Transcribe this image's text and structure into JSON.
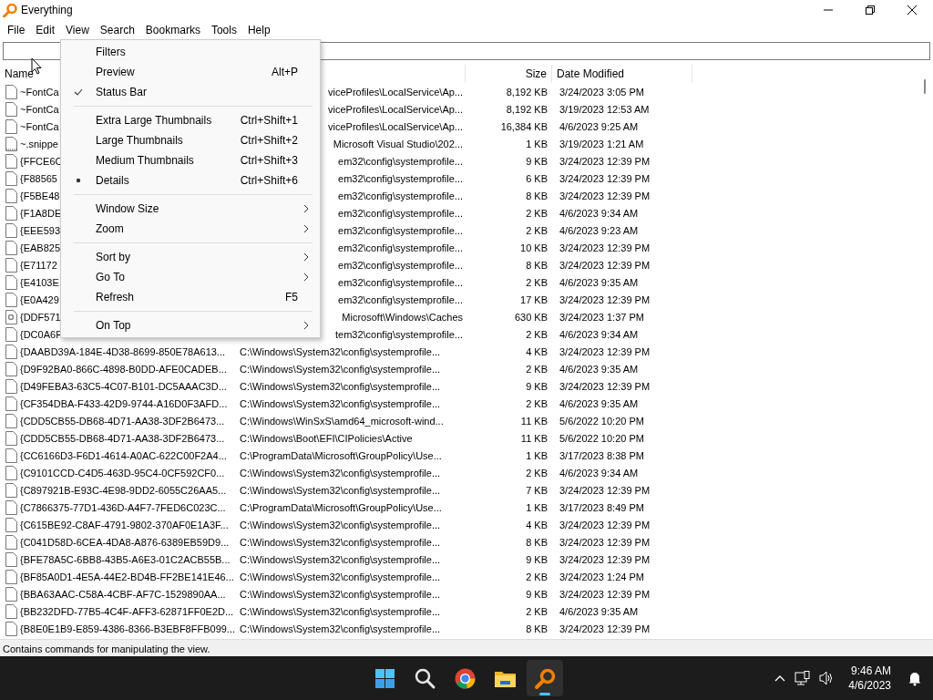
{
  "window": {
    "title": "Everything"
  },
  "menubar": [
    {
      "label": "File"
    },
    {
      "label": "Edit"
    },
    {
      "label": "View"
    },
    {
      "label": "Search"
    },
    {
      "label": "Bookmarks"
    },
    {
      "label": "Tools"
    },
    {
      "label": "Help"
    }
  ],
  "view_menu": [
    [
      {
        "kind": "command",
        "label": "Filters"
      },
      {
        "kind": "command",
        "label": "Preview",
        "shortcut": "Alt+P"
      },
      {
        "kind": "check",
        "label": "Status Bar",
        "checked": true
      }
    ],
    [
      {
        "kind": "radio",
        "label": "Extra Large Thumbnails",
        "shortcut": "Ctrl+Shift+1",
        "checked": false
      },
      {
        "kind": "radio",
        "label": "Large Thumbnails",
        "shortcut": "Ctrl+Shift+2",
        "checked": false
      },
      {
        "kind": "radio",
        "label": "Medium Thumbnails",
        "shortcut": "Ctrl+Shift+3",
        "checked": false
      },
      {
        "kind": "radio",
        "label": "Details",
        "shortcut": "Ctrl+Shift+6",
        "checked": true
      }
    ],
    [
      {
        "kind": "submenu",
        "label": "Window Size"
      },
      {
        "kind": "submenu",
        "label": "Zoom"
      }
    ],
    [
      {
        "kind": "submenu",
        "label": "Sort by"
      },
      {
        "kind": "submenu",
        "label": "Go To"
      },
      {
        "kind": "command",
        "label": "Refresh",
        "shortcut": "F5"
      }
    ],
    [
      {
        "kind": "submenu",
        "label": "On Top"
      }
    ]
  ],
  "table": {
    "columns": [
      {
        "label": "Name"
      },
      {
        "label": "Size"
      },
      {
        "label": "Date Modified"
      }
    ],
    "rows": [
      {
        "kind": "plain",
        "covered": true,
        "name": "~FontCa",
        "path": "viceProfiles\\LocalService\\Ap...",
        "size": "8,192 KB",
        "date": "3/24/2023 3:05 PM"
      },
      {
        "kind": "plain",
        "covered": true,
        "name": "~FontCa",
        "path": "viceProfiles\\LocalService\\Ap...",
        "size": "8,192 KB",
        "date": "3/19/2023 12:53 AM"
      },
      {
        "kind": "plain",
        "covered": true,
        "name": "~FontCa",
        "path": "viceProfiles\\LocalService\\Ap...",
        "size": "16,384 KB",
        "date": "4/6/2023 9:25 AM"
      },
      {
        "kind": "dotted",
        "covered": true,
        "name": "~.snippe",
        "path": "Microsoft Visual Studio\\202...",
        "size": "1 KB",
        "date": "3/19/2023 1:21 AM"
      },
      {
        "kind": "plain",
        "covered": true,
        "name": "{FFCE6C",
        "path": "em32\\config\\systemprofile...",
        "size": "9 KB",
        "date": "3/24/2023 12:39 PM"
      },
      {
        "kind": "plain",
        "covered": true,
        "name": "{F88565",
        "path": "em32\\config\\systemprofile...",
        "size": "6 KB",
        "date": "3/24/2023 12:39 PM"
      },
      {
        "kind": "plain",
        "covered": true,
        "name": "{F5BE48",
        "path": "em32\\config\\systemprofile...",
        "size": "8 KB",
        "date": "3/24/2023 12:39 PM"
      },
      {
        "kind": "plain",
        "covered": true,
        "name": "{F1A8DE",
        "path": "em32\\config\\systemprofile...",
        "size": "2 KB",
        "date": "4/6/2023 9:34 AM"
      },
      {
        "kind": "plain",
        "covered": true,
        "name": "{EEE593",
        "path": "em32\\config\\systemprofile...",
        "size": "2 KB",
        "date": "4/6/2023 9:23 AM"
      },
      {
        "kind": "plain",
        "covered": true,
        "name": "{EAB825",
        "path": "em32\\config\\systemprofile...",
        "size": "10 KB",
        "date": "3/24/2023 12:39 PM"
      },
      {
        "kind": "plain",
        "covered": true,
        "name": "{E71172",
        "path": "em32\\config\\systemprofile...",
        "size": "8 KB",
        "date": "3/24/2023 12:39 PM"
      },
      {
        "kind": "plain",
        "covered": true,
        "name": "{E4103E",
        "path": "em32\\config\\systemprofile...",
        "size": "2 KB",
        "date": "4/6/2023 9:35 AM"
      },
      {
        "kind": "plain",
        "covered": true,
        "name": "{E0A429",
        "path": "em32\\config\\systemprofile...",
        "size": "17 KB",
        "date": "3/24/2023 12:39 PM"
      },
      {
        "kind": "badge",
        "covered": true,
        "name": "{DDF571",
        "path": "Microsoft\\Windows\\Caches",
        "size": "630 KB",
        "date": "3/24/2023 1:37 PM"
      },
      {
        "kind": "plain",
        "covered": true,
        "name": "{DC0A6F",
        "path": "tem32\\config\\systemprofile...",
        "size": "2 KB",
        "date": "4/6/2023 9:34 AM"
      },
      {
        "kind": "plain",
        "covered": false,
        "name": "{DAABD39A-184E-4D38-8699-850E78A613...",
        "path": "C:\\Windows\\System32\\config\\systemprofile...",
        "size": "4 KB",
        "date": "3/24/2023 12:39 PM"
      },
      {
        "kind": "plain",
        "covered": false,
        "name": "{D9F92BA0-866C-4898-B0DD-AFE0CADEB...",
        "path": "C:\\Windows\\System32\\config\\systemprofile...",
        "size": "2 KB",
        "date": "4/6/2023 9:35 AM"
      },
      {
        "kind": "plain",
        "covered": false,
        "name": "{D49FEBA3-63C5-4C07-B101-DC5AAAC3D...",
        "path": "C:\\Windows\\System32\\config\\systemprofile...",
        "size": "9 KB",
        "date": "3/24/2023 12:39 PM"
      },
      {
        "kind": "plain",
        "covered": false,
        "name": "{CF354DBA-F433-42D9-9744-A16D0F3AFD...",
        "path": "C:\\Windows\\System32\\config\\systemprofile...",
        "size": "2 KB",
        "date": "4/6/2023 9:35 AM"
      },
      {
        "kind": "plain",
        "covered": false,
        "name": "{CDD5CB55-DB68-4D71-AA38-3DF2B6473...",
        "path": "C:\\Windows\\WinSxS\\amd64_microsoft-wind...",
        "size": "11 KB",
        "date": "5/6/2022 10:20 PM"
      },
      {
        "kind": "plain",
        "covered": false,
        "name": "{CDD5CB55-DB68-4D71-AA38-3DF2B6473...",
        "path": "C:\\Windows\\Boot\\EFI\\CIPolicies\\Active",
        "size": "11 KB",
        "date": "5/6/2022 10:20 PM"
      },
      {
        "kind": "plain",
        "covered": false,
        "name": "{CC6166D3-F6D1-4614-A0AC-622C00F2A4...",
        "path": "C:\\ProgramData\\Microsoft\\GroupPolicy\\Use...",
        "size": "1 KB",
        "date": "3/17/2023 8:38 PM"
      },
      {
        "kind": "plain",
        "covered": false,
        "name": "{C9101CCD-C4D5-463D-95C4-0CF592CF0...",
        "path": "C:\\Windows\\System32\\config\\systemprofile...",
        "size": "2 KB",
        "date": "4/6/2023 9:34 AM"
      },
      {
        "kind": "plain",
        "covered": false,
        "name": "{C897921B-E93C-4E98-9DD2-6055C26AA5...",
        "path": "C:\\Windows\\System32\\config\\systemprofile...",
        "size": "7 KB",
        "date": "3/24/2023 12:39 PM"
      },
      {
        "kind": "plain",
        "covered": false,
        "name": "{C7866375-77D1-436D-A4F7-7FED6C023C...",
        "path": "C:\\ProgramData\\Microsoft\\GroupPolicy\\Use...",
        "size": "1 KB",
        "date": "3/17/2023 8:49 PM"
      },
      {
        "kind": "plain",
        "covered": false,
        "name": "{C615BE92-C8AF-4791-9802-370AF0E1A3F...",
        "path": "C:\\Windows\\System32\\config\\systemprofile...",
        "size": "4 KB",
        "date": "3/24/2023 12:39 PM"
      },
      {
        "kind": "plain",
        "covered": false,
        "name": "{C041D58D-6CEA-4DA8-A876-6389EB59D9...",
        "path": "C:\\Windows\\System32\\config\\systemprofile...",
        "size": "8 KB",
        "date": "3/24/2023 12:39 PM"
      },
      {
        "kind": "plain",
        "covered": false,
        "name": "{BFE78A5C-6BB8-43B5-A6E3-01C2ACB55B...",
        "path": "C:\\Windows\\System32\\config\\systemprofile...",
        "size": "9 KB",
        "date": "3/24/2023 12:39 PM"
      },
      {
        "kind": "plain",
        "covered": false,
        "name": "{BF85A0D1-4E5A-44E2-BD4B-FF2BE141E46...",
        "path": "C:\\Windows\\System32\\config\\systemprofile...",
        "size": "2 KB",
        "date": "3/24/2023 1:24 PM"
      },
      {
        "kind": "plain",
        "covered": false,
        "name": "{BBA63AAC-C58A-4CBF-AF7C-1529890AA...",
        "path": "C:\\Windows\\System32\\config\\systemprofile...",
        "size": "9 KB",
        "date": "3/24/2023 12:39 PM"
      },
      {
        "kind": "plain",
        "covered": false,
        "name": "{BB232DFD-77B5-4C4F-AFF3-62871FF0E2D...",
        "path": "C:\\Windows\\System32\\config\\systemprofile...",
        "size": "2 KB",
        "date": "4/6/2023 9:35 AM"
      },
      {
        "kind": "plain",
        "covered": false,
        "name": "{B8E0E1B9-E859-4386-8366-B3EBF8FFB099...",
        "path": "C:\\Windows\\System32\\config\\systemprofile...",
        "size": "8 KB",
        "date": "3/24/2023 12:39 PM"
      }
    ]
  },
  "status_bar": "Contains commands for manipulating the view.",
  "taskbar": {
    "apps": [
      {
        "kind": "start",
        "selected": false
      },
      {
        "kind": "search",
        "selected": false
      },
      {
        "kind": "browser",
        "selected": false
      },
      {
        "kind": "folder",
        "selected": false
      },
      {
        "kind": "everything",
        "selected": true
      }
    ],
    "time": "9:46 AM",
    "date": "4/6/2023"
  }
}
